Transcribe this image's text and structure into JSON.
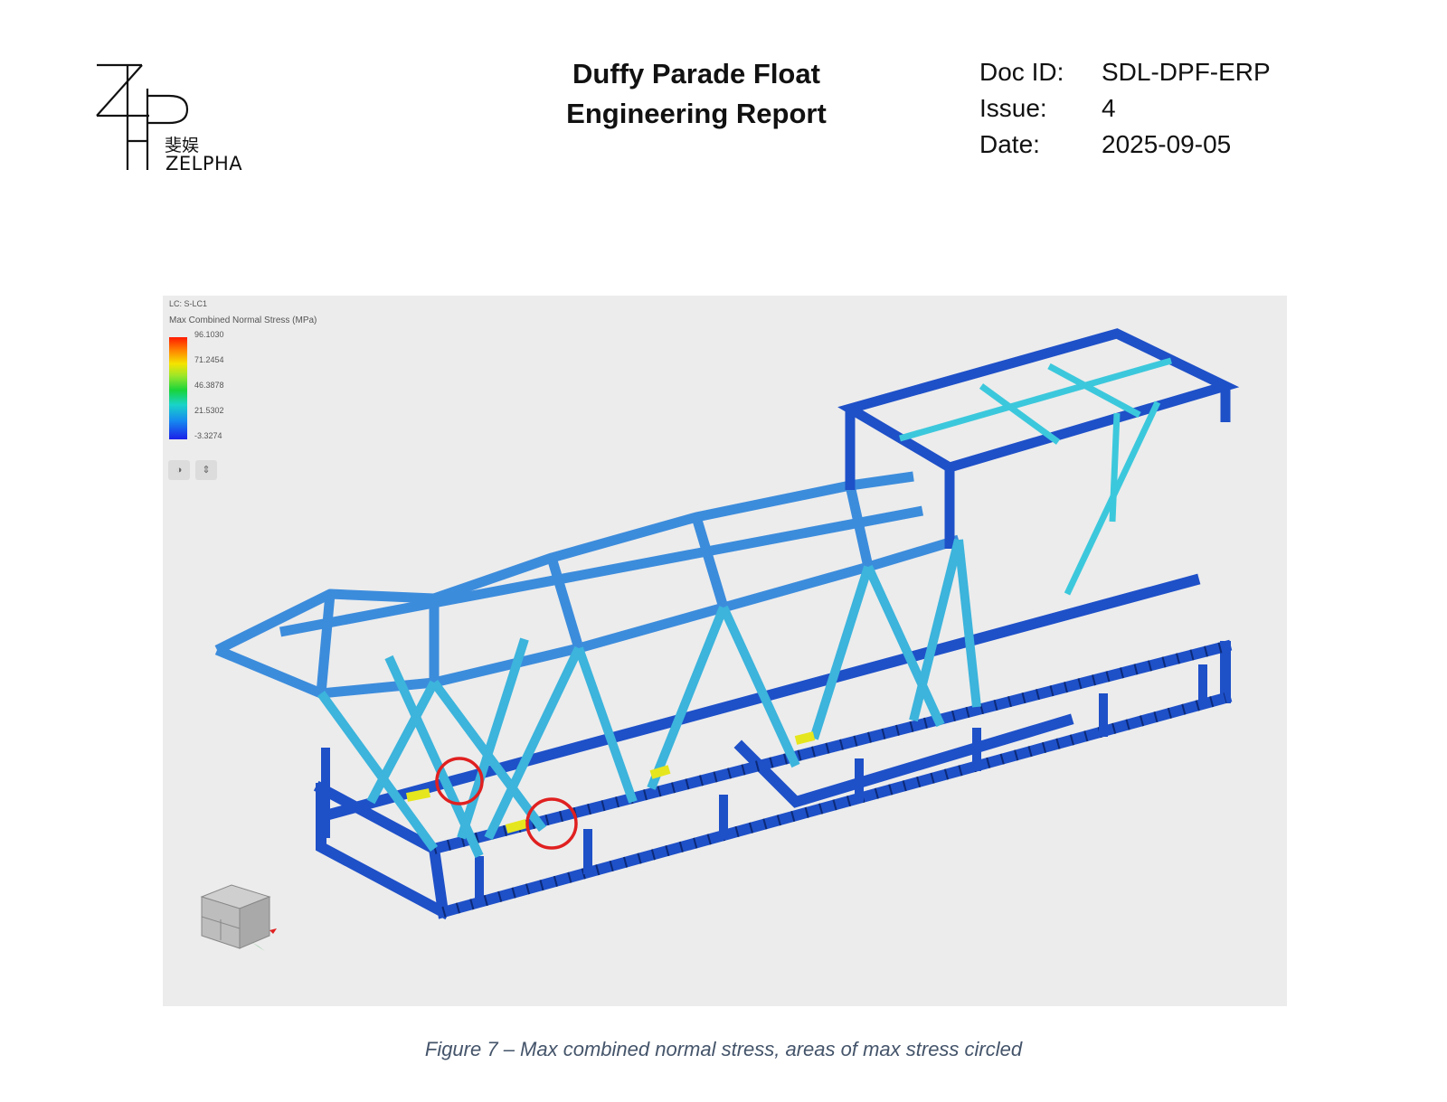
{
  "header": {
    "logo_name": "ZELPHA",
    "logo_name_cn": "斐娱",
    "title_line1": "Duffy Parade Float",
    "title_line2": "Engineering Report",
    "meta": [
      {
        "key": "Doc ID:",
        "value": "SDL-DPF-ERP"
      },
      {
        "key": "Issue:",
        "value": "4"
      },
      {
        "key": "Date:",
        "value": "2025-09-05"
      }
    ]
  },
  "figure": {
    "load_case": "LC: S-LC1",
    "legend_title": "Max Combined Normal Stress (MPa)",
    "legend_ticks": [
      "96.1030",
      "71.2454",
      "46.3878",
      "21.5302",
      "-3.3274"
    ],
    "colors": {
      "background": "#ececec",
      "member_dark": "#1e50c8",
      "member_mid": "#3c8cdc",
      "member_light": "#3cc8dc",
      "highlight": "#e6e61e",
      "circle": "#e02020"
    },
    "buttons": [
      {
        "icon": "contrast-icon",
        "glyph": "◑"
      },
      {
        "icon": "sort-icon",
        "glyph": "⇕"
      }
    ]
  },
  "caption": "Figure 7 – Max combined normal stress, areas of max stress circled"
}
